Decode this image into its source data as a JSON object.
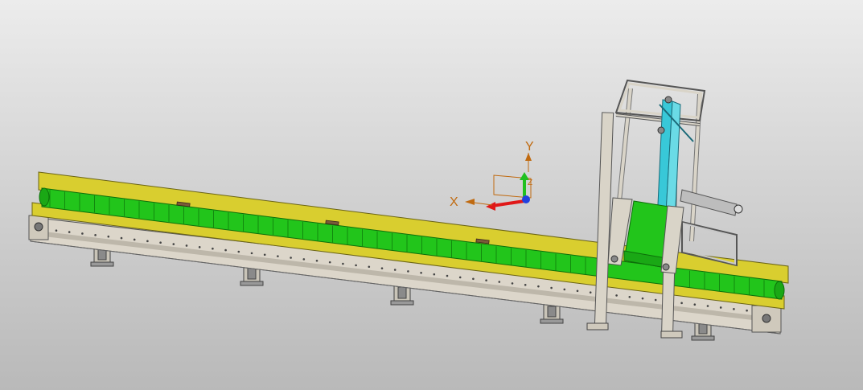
{
  "viewport": {
    "triad": {
      "x_label": "X",
      "y_label": "Y",
      "z_label": "Z",
      "x_color": "#e01818",
      "y_color": "#20c020",
      "z_color": "#2040e0",
      "label_color": "#c06a10"
    }
  },
  "model": {
    "belt_color": "#22c51b",
    "belt_dark": "#138c10",
    "rail_color": "#d8cc2e",
    "frame_color": "#d9d4c8",
    "accent_cyan": "#38c8d8"
  }
}
